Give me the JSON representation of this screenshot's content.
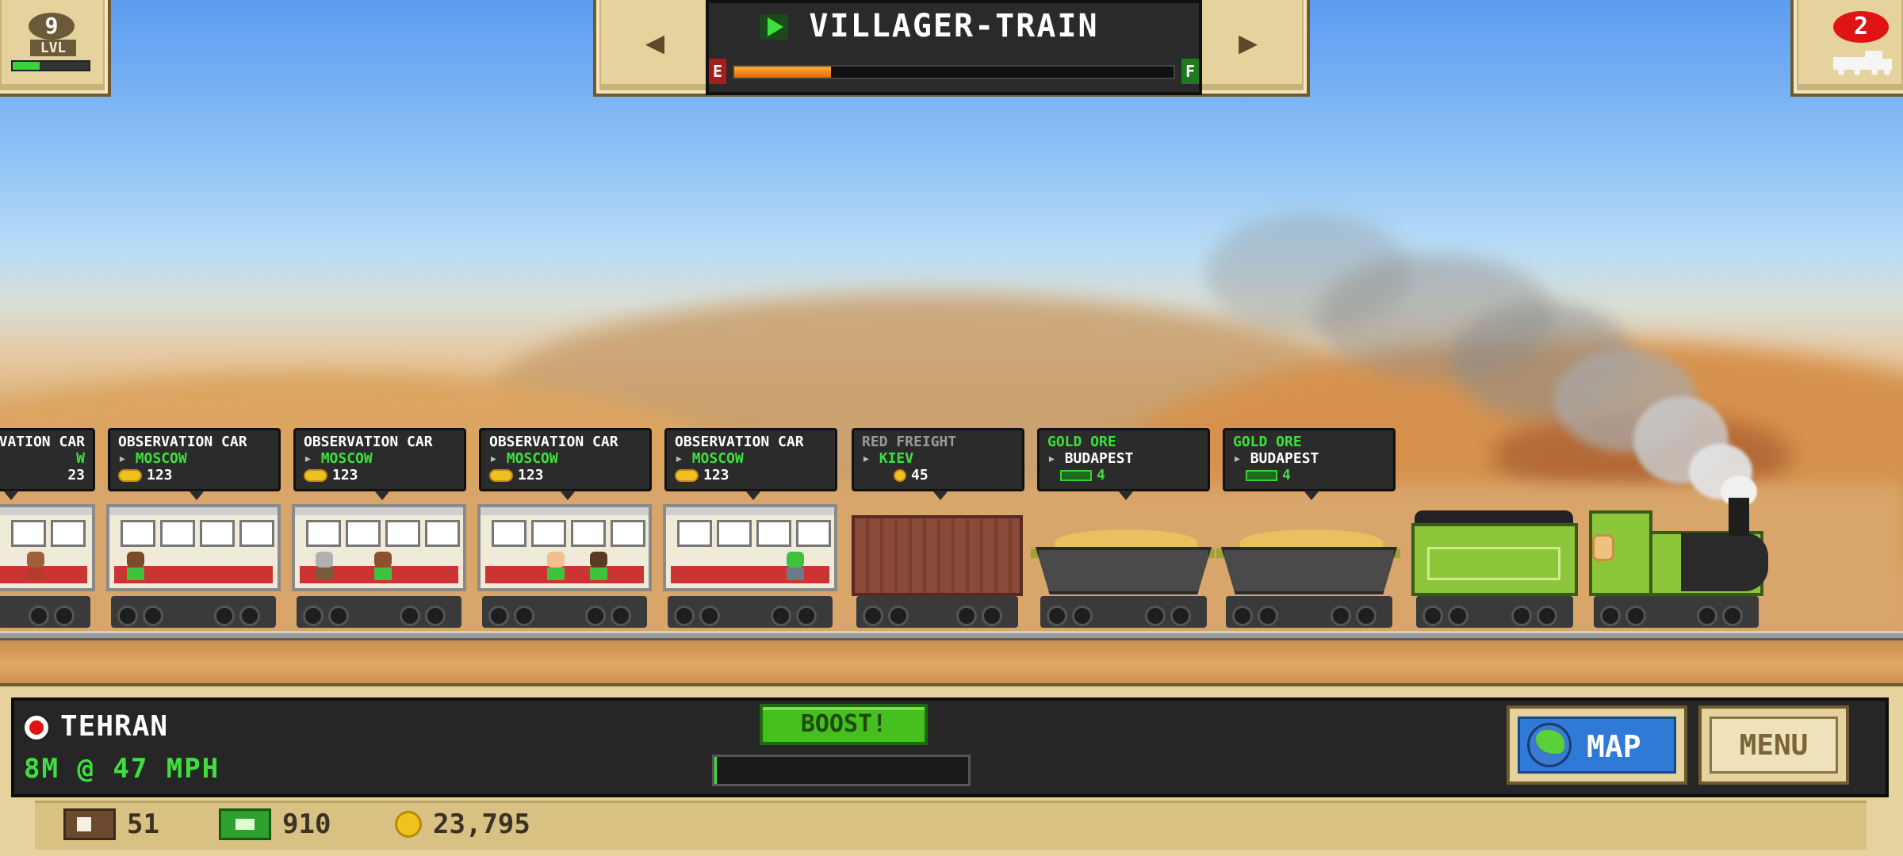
{
  "top": {
    "level_number": "9",
    "level_label": "LVL",
    "level_progress": 0.35,
    "train_name": "VILLAGER-TRAIN",
    "fuel_empty": "E",
    "fuel_full": "F",
    "fuel_level": 0.22,
    "nav_prev": "◀",
    "nav_next": "▶",
    "alerts_count": "2"
  },
  "cars": [
    {
      "type": "OBSERVATION CAR",
      "title_visible": "VATION CAR",
      "dest": "W",
      "value": "23",
      "kind": "coins"
    },
    {
      "type": "OBSERVATION CAR",
      "dest": "MOSCOW",
      "value": "123",
      "kind": "coins"
    },
    {
      "type": "OBSERVATION CAR",
      "dest": "MOSCOW",
      "value": "123",
      "kind": "coins"
    },
    {
      "type": "OBSERVATION CAR",
      "dest": "MOSCOW",
      "value": "123",
      "kind": "coins"
    },
    {
      "type": "OBSERVATION CAR",
      "dest": "MOSCOW",
      "value": "123",
      "kind": "coins"
    },
    {
      "type": "RED FREIGHT",
      "dest": "KIEV",
      "value": "45",
      "kind": "coin"
    },
    {
      "type": "GOLD ORE",
      "dest": "BUDAPEST",
      "value": "4",
      "kind": "cargo"
    },
    {
      "type": "GOLD ORE",
      "dest": "BUDAPEST",
      "value": "4",
      "kind": "cargo"
    }
  ],
  "status": {
    "location": "TEHRAN",
    "speed_text": "8M @ 47 MPH",
    "boost_label": "BOOST!",
    "boost_progress": 0.01,
    "map_label": "MAP",
    "menu_label": "MENU"
  },
  "resources": {
    "tickets": "51",
    "cash": "910",
    "coins": "23,795"
  },
  "colors": {
    "accent_green": "#3ee03e",
    "alert_red": "#e01414",
    "panel_tan": "#e5d29c",
    "map_blue": "#2e7ad6"
  },
  "icons": [
    "play-icon",
    "location-pin-icon",
    "globe-icon",
    "ticket-icon",
    "cash-icon",
    "coin-icon",
    "train-icon",
    "arrow-left-icon",
    "arrow-right-icon"
  ]
}
